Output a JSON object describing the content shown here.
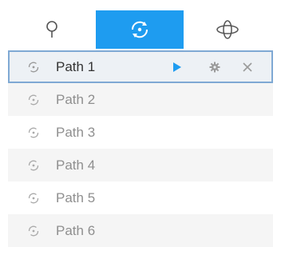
{
  "tabs": [
    {
      "icon": "preset-pin-icon",
      "active": false
    },
    {
      "icon": "patrol-path-icon",
      "active": true
    },
    {
      "icon": "pattern-orbit-icon",
      "active": false
    }
  ],
  "paths": [
    {
      "label": "Path 1",
      "selected": true
    },
    {
      "label": "Path 2",
      "selected": false
    },
    {
      "label": "Path 3",
      "selected": false
    },
    {
      "label": "Path 4",
      "selected": false
    },
    {
      "label": "Path 5",
      "selected": false
    },
    {
      "label": "Path 6",
      "selected": false
    }
  ],
  "row_actions": [
    "play-icon",
    "gear-icon",
    "close-icon"
  ],
  "colors": {
    "accent": "#1e9cf0",
    "selected_border": "#7fa9d4",
    "alt_row": "#f5f5f5",
    "muted_text": "#8f8f8f"
  }
}
